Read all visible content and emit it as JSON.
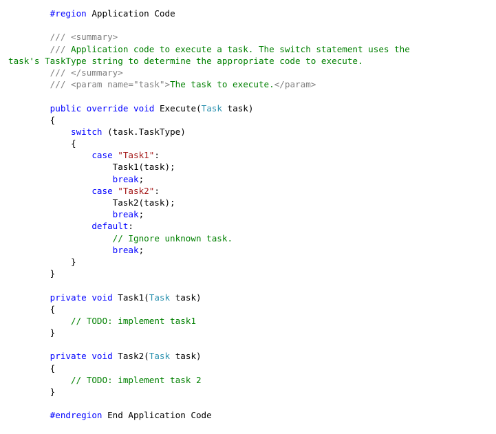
{
  "colors": {
    "background": "#ffffff",
    "plain": "#000000",
    "keyword": "#0000ff",
    "type": "#2b91af",
    "string": "#a31515",
    "comment": "#008000",
    "doc_tag": "#808080"
  },
  "editor": {
    "lines": [
      [
        {
          "t": "        ",
          "k": "plain"
        },
        {
          "t": "#region",
          "k": "keyword"
        },
        {
          "t": " Application Code",
          "k": "plain"
        }
      ],
      [],
      [
        {
          "t": "        ",
          "k": "plain"
        },
        {
          "t": "/// <summary>",
          "k": "doc-tag"
        }
      ],
      [
        {
          "t": "        ",
          "k": "plain"
        },
        {
          "t": "///",
          "k": "doc-tag"
        },
        {
          "t": " Application code to execute a task. The switch statement uses the",
          "k": "comment"
        }
      ],
      [
        {
          "t": "task's TaskType string to determine the appropriate code to execute.",
          "k": "comment"
        }
      ],
      [
        {
          "t": "        ",
          "k": "plain"
        },
        {
          "t": "/// </summary>",
          "k": "doc-tag"
        }
      ],
      [
        {
          "t": "        ",
          "k": "plain"
        },
        {
          "t": "/// <param name=\"task\">",
          "k": "doc-tag"
        },
        {
          "t": "The task to execute.",
          "k": "comment"
        },
        {
          "t": "</param>",
          "k": "doc-tag"
        }
      ],
      [],
      [
        {
          "t": "        ",
          "k": "plain"
        },
        {
          "t": "public",
          "k": "keyword"
        },
        {
          "t": " ",
          "k": "plain"
        },
        {
          "t": "override",
          "k": "keyword"
        },
        {
          "t": " ",
          "k": "plain"
        },
        {
          "t": "void",
          "k": "keyword"
        },
        {
          "t": " Execute(",
          "k": "plain"
        },
        {
          "t": "Task",
          "k": "type"
        },
        {
          "t": " task)",
          "k": "plain"
        }
      ],
      [
        {
          "t": "        {",
          "k": "plain"
        }
      ],
      [
        {
          "t": "            ",
          "k": "plain"
        },
        {
          "t": "switch",
          "k": "keyword"
        },
        {
          "t": " (task.TaskType)",
          "k": "plain"
        }
      ],
      [
        {
          "t": "            {",
          "k": "plain"
        }
      ],
      [
        {
          "t": "                ",
          "k": "plain"
        },
        {
          "t": "case",
          "k": "keyword"
        },
        {
          "t": " ",
          "k": "plain"
        },
        {
          "t": "\"Task1\"",
          "k": "string"
        },
        {
          "t": ":",
          "k": "plain"
        }
      ],
      [
        {
          "t": "                    Task1(task);",
          "k": "plain"
        }
      ],
      [
        {
          "t": "                    ",
          "k": "plain"
        },
        {
          "t": "break",
          "k": "keyword"
        },
        {
          "t": ";",
          "k": "plain"
        }
      ],
      [
        {
          "t": "                ",
          "k": "plain"
        },
        {
          "t": "case",
          "k": "keyword"
        },
        {
          "t": " ",
          "k": "plain"
        },
        {
          "t": "\"Task2\"",
          "k": "string"
        },
        {
          "t": ":",
          "k": "plain"
        }
      ],
      [
        {
          "t": "                    Task2(task);",
          "k": "plain"
        }
      ],
      [
        {
          "t": "                    ",
          "k": "plain"
        },
        {
          "t": "break",
          "k": "keyword"
        },
        {
          "t": ";",
          "k": "plain"
        }
      ],
      [
        {
          "t": "                ",
          "k": "plain"
        },
        {
          "t": "default",
          "k": "keyword"
        },
        {
          "t": ":",
          "k": "plain"
        }
      ],
      [
        {
          "t": "                    ",
          "k": "plain"
        },
        {
          "t": "// Ignore unknown task.",
          "k": "comment"
        }
      ],
      [
        {
          "t": "                    ",
          "k": "plain"
        },
        {
          "t": "break",
          "k": "keyword"
        },
        {
          "t": ";",
          "k": "plain"
        }
      ],
      [
        {
          "t": "            }",
          "k": "plain"
        }
      ],
      [
        {
          "t": "        }",
          "k": "plain"
        }
      ],
      [],
      [
        {
          "t": "        ",
          "k": "plain"
        },
        {
          "t": "private",
          "k": "keyword"
        },
        {
          "t": " ",
          "k": "plain"
        },
        {
          "t": "void",
          "k": "keyword"
        },
        {
          "t": " Task1(",
          "k": "plain"
        },
        {
          "t": "Task",
          "k": "type"
        },
        {
          "t": " task)",
          "k": "plain"
        }
      ],
      [
        {
          "t": "        {",
          "k": "plain"
        }
      ],
      [
        {
          "t": "            ",
          "k": "plain"
        },
        {
          "t": "// TODO: implement task1",
          "k": "comment"
        }
      ],
      [
        {
          "t": "        }",
          "k": "plain"
        }
      ],
      [],
      [
        {
          "t": "        ",
          "k": "plain"
        },
        {
          "t": "private",
          "k": "keyword"
        },
        {
          "t": " ",
          "k": "plain"
        },
        {
          "t": "void",
          "k": "keyword"
        },
        {
          "t": " Task2(",
          "k": "plain"
        },
        {
          "t": "Task",
          "k": "type"
        },
        {
          "t": " task)",
          "k": "plain"
        }
      ],
      [
        {
          "t": "        {",
          "k": "plain"
        }
      ],
      [
        {
          "t": "            ",
          "k": "plain"
        },
        {
          "t": "// TODO: implement task 2",
          "k": "comment"
        }
      ],
      [
        {
          "t": "        }",
          "k": "plain"
        }
      ],
      [],
      [
        {
          "t": "        ",
          "k": "plain"
        },
        {
          "t": "#endregion",
          "k": "keyword"
        },
        {
          "t": " End Application Code",
          "k": "plain"
        }
      ]
    ]
  }
}
